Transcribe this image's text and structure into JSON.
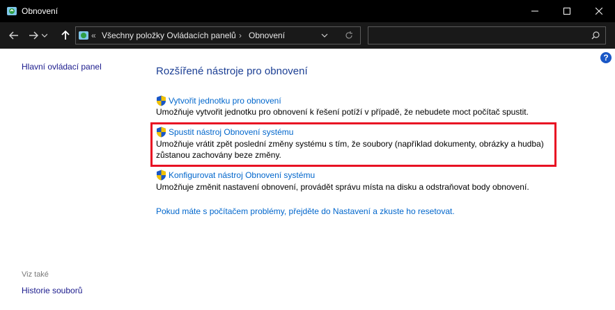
{
  "window": {
    "title": "Obnovení"
  },
  "address_bar": {
    "overflow": "«",
    "crumb1": "Všechny položky Ovládacích panelů",
    "separator": "›",
    "crumb2": "Obnovení"
  },
  "search": {
    "placeholder": ""
  },
  "left_nav": {
    "home_link": "Hlavní ovládací panel",
    "see_also": "Viz také",
    "history_link": "Historie souborů"
  },
  "main": {
    "title": "Rozšířené nástroje pro obnovení",
    "items": [
      {
        "link": "Vytvořit jednotku pro obnovení",
        "desc1": "Umožňuje vytvořit jednotku pro obnovení k řešení potíží v případě, že nebudete moct  počítač spustit.",
        "desc2": ""
      },
      {
        "link": "Spustit nástroj Obnovení systému",
        "desc1": "Umožňuje vrátit zpět poslední změny systému s tím, že soubory (například dokumenty, obrázky a hudba)",
        "desc2": "zůstanou zachovány beze změny."
      },
      {
        "link": "Konfigurovat nástroj Obnovení systému",
        "desc1": "Umožňuje změnit nastavení obnovení, provádět správu místa na disku a odstraňovat body obnovení.",
        "desc2": ""
      }
    ],
    "reset_link": "Pokud máte s počítačem problémy, přejděte do Nastavení a zkuste ho resetovat."
  },
  "help": {
    "label": "?"
  },
  "colors": {
    "highlight": "#e81123",
    "link": "#0066cc",
    "title": "#1c3f94"
  }
}
